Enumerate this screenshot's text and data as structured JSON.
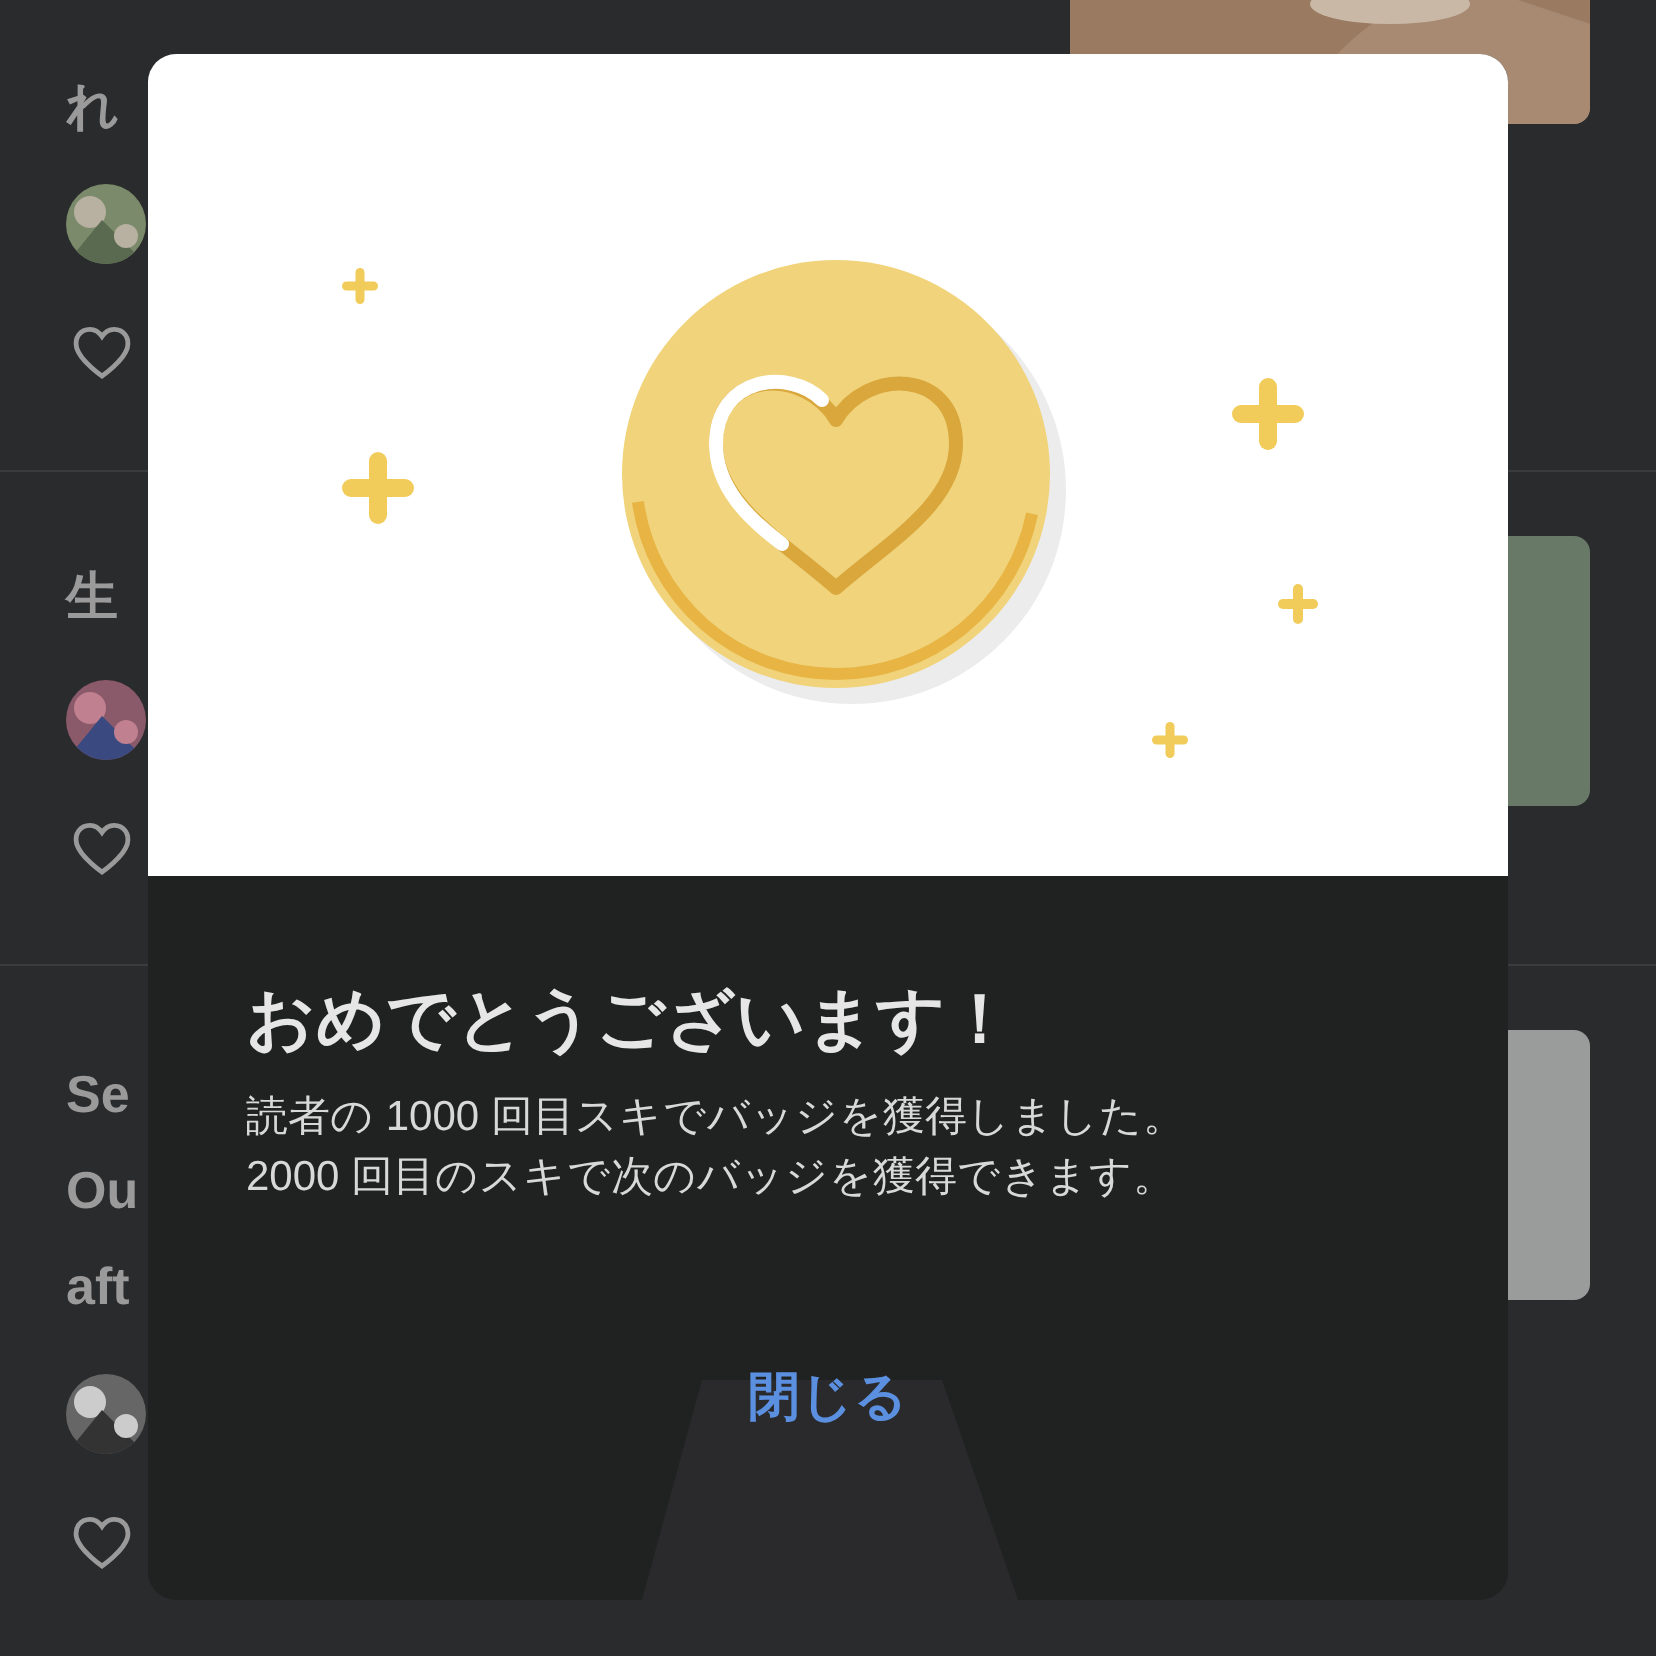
{
  "feed": [
    {
      "title_lines": [
        "れ"
      ],
      "thumbnail": {
        "kind": "picture"
      }
    },
    {
      "title_lines": [
        "生"
      ],
      "thumbnail": {
        "kind": "flat",
        "color": "#687968"
      }
    },
    {
      "title_lines": [
        "Se",
        "Ou",
        "aft"
      ],
      "thumbnail": {
        "kind": "flat",
        "color": "#9a9c9c"
      }
    }
  ],
  "dialog": {
    "title": "おめでとうございます！",
    "message_lines": [
      "読者の 1000 回目スキでバッジを獲得しました。",
      "2000 回目のスキで次のバッジを獲得できます。"
    ],
    "close_button": "閉じる"
  }
}
